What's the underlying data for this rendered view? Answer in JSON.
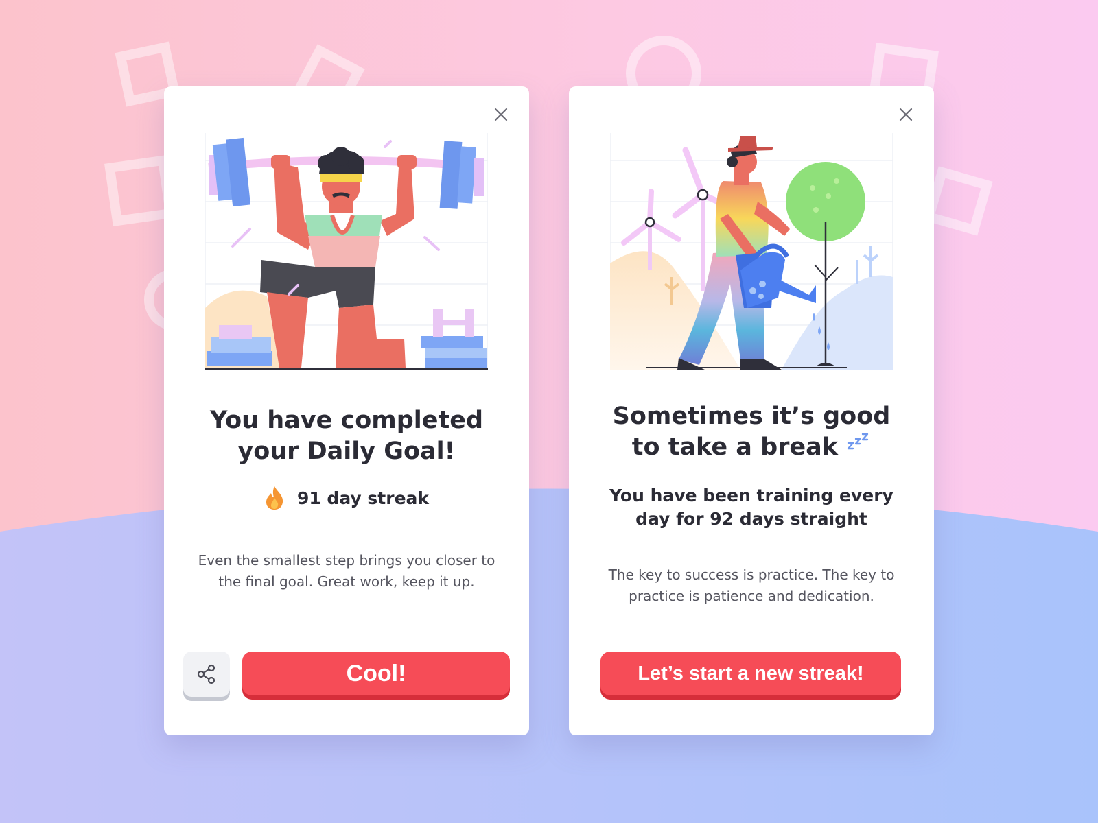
{
  "colors": {
    "accent": "#f64c57",
    "accent_shadow": "#d62e3a",
    "text": "#2b2b35",
    "muted_text": "#55555f"
  },
  "cards": [
    {
      "close_icon": "close-icon",
      "illustration": "weightlifter-illustration",
      "title_line1": "You have completed",
      "title_line2": "your Daily Goal!",
      "streak_icon": "flame-icon",
      "streak_text": "91 day streak",
      "message_line1": "Even the smallest step brings you closer to",
      "message_line2": "the final goal. Great work, keep it up.",
      "share_icon": "share-icon",
      "button_label": "Cool!"
    },
    {
      "close_icon": "close-icon",
      "illustration": "gardener-illustration",
      "title_line1": "Sometimes it’s good",
      "title_line2": "to take a break",
      "sleep_icon": "zzz-icon",
      "subtitle_line1": "You have been training every",
      "subtitle_line2": "day for 92 days straight",
      "message_line1": "The key to success is practice. The key to",
      "message_line2": "practice is patience and dedication.",
      "button_label": "Let’s start a new streak!"
    }
  ]
}
